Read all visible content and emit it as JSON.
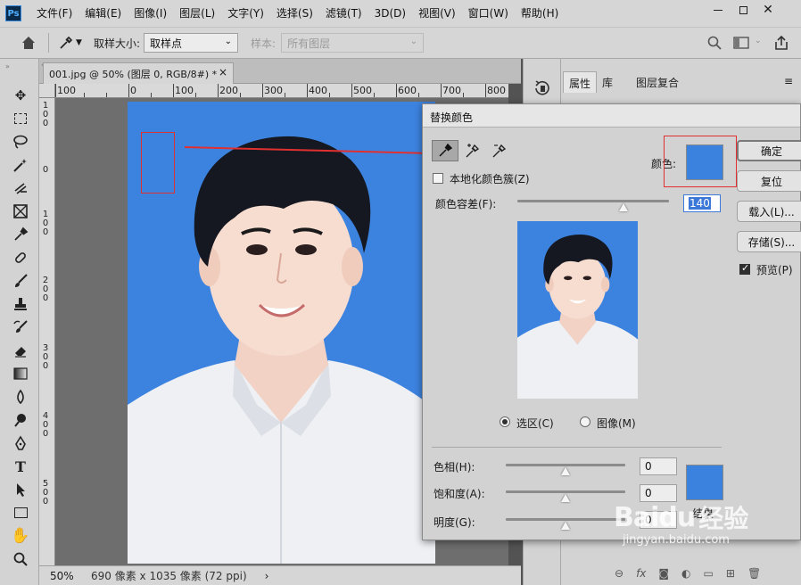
{
  "menu": [
    "文件(F)",
    "编辑(E)",
    "图像(I)",
    "图层(L)",
    "文字(Y)",
    "选择(S)",
    "滤镜(T)",
    "3D(D)",
    "视图(V)",
    "窗口(W)",
    "帮助(H)"
  ],
  "app_logo": "Ps",
  "options": {
    "sample_size_label": "取样大小:",
    "sample_size_value": "取样点",
    "sample_label": "样本:",
    "sample_value": "所有图层"
  },
  "document": {
    "tab_title": "001.jpg @ 50% (图层 0, RGB/8#) *",
    "zoom": "50%",
    "dimensions": "690 像素 x 1035 像素 (72 ppi)"
  },
  "ruler_h_labels": [
    "100",
    "0",
    "100",
    "200",
    "300",
    "400",
    "500",
    "600",
    "700",
    "800"
  ],
  "ruler_v_labels": [
    "1 0 0",
    "0",
    "1 0 0",
    "2 0 0",
    "3 0 0",
    "4 0 0",
    "5 0 0"
  ],
  "panel_tabs": [
    "属性",
    "库",
    "图层复合"
  ],
  "dialog": {
    "title": "替换颜色",
    "localized_label": "本地化颜色簇(Z)",
    "color_label": "颜色:",
    "tolerance_label": "颜色容差(F):",
    "tolerance_value": "140",
    "tolerance": 140,
    "tolerance_max": 200,
    "radio_selection": "选区(C)",
    "radio_image": "图像(M)",
    "hue_label": "色相(H):",
    "hue_value": "0",
    "saturation_label": "饱和度(A):",
    "saturation_value": "0",
    "lightness_label": "明度(G):",
    "lightness_value": "0",
    "result_label": "结果",
    "buttons": {
      "ok": "确定",
      "reset": "复位",
      "load": "载入(L)...",
      "save": "存储(S)...",
      "preview": "预览(P)"
    },
    "preview_checked": true,
    "localized_checked": false
  },
  "colors": {
    "sampled": "#3b82df",
    "result": "#3b82df",
    "annotation": "#e03030"
  },
  "watermark": {
    "brand": "Baidu",
    "brand_suffix": "经验",
    "url": "jingyan.baidu.com"
  }
}
